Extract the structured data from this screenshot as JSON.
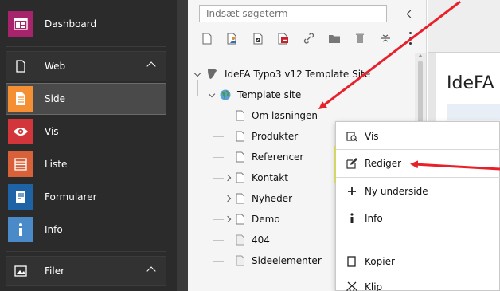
{
  "module_menu": {
    "dashboard": {
      "label": "Dashboard",
      "color": "#a7246d"
    },
    "web_group": {
      "label": "Web"
    },
    "items": [
      {
        "label": "Side",
        "color": "#f49033",
        "icon": "page-icon"
      },
      {
        "label": "Vis",
        "color": "#d2363a",
        "icon": "eye-icon"
      },
      {
        "label": "Liste",
        "color": "#d9613a",
        "icon": "list-icon"
      },
      {
        "label": "Formularer",
        "color": "#1e63a6",
        "icon": "form-icon"
      },
      {
        "label": "Info",
        "color": "#4b8ac9",
        "icon": "info-icon"
      }
    ],
    "filer_group": {
      "label": "Filer"
    }
  },
  "tree": {
    "search_placeholder": "Indsæt søgeterm",
    "toolbar_icons": [
      "new-page-icon",
      "new-page-user-icon",
      "new-shortcut-icon",
      "new-mountpoint-icon",
      "new-link-icon",
      "new-folder-icon",
      "recycler-icon",
      "divider-icon"
    ],
    "root": {
      "label": "IdeFA Typo3 v12 Template Site"
    },
    "site": {
      "label": "Template site"
    },
    "pages": [
      {
        "label": "Om løsningen",
        "expandable": false
      },
      {
        "label": "Produkter",
        "expandable": false
      },
      {
        "label": "Referencer",
        "expandable": false
      },
      {
        "label": "Kontakt",
        "expandable": true
      },
      {
        "label": "Nyheder",
        "expandable": true
      },
      {
        "label": "Demo",
        "expandable": true
      },
      {
        "label": "404",
        "expandable": false
      },
      {
        "label": "Sideelementer",
        "expandable": false
      }
    ]
  },
  "content": {
    "title": "IdeFA"
  },
  "context_menu": {
    "items": [
      {
        "label": "Vis",
        "icon": "view-icon"
      },
      {
        "label": "Rediger",
        "icon": "edit-icon",
        "highlighted": true
      },
      {
        "label": "Ny underside",
        "icon": "plus-icon"
      },
      {
        "label": "Info",
        "icon": "info-icon"
      },
      {
        "label": "Kopier",
        "icon": "copy-icon"
      },
      {
        "label": "Klip",
        "icon": "cut-icon"
      }
    ]
  },
  "colors": {
    "annotation_arrow": "#e8202a",
    "highlight": "#fefe00",
    "module_menu_bg": "#2b2b2b"
  }
}
